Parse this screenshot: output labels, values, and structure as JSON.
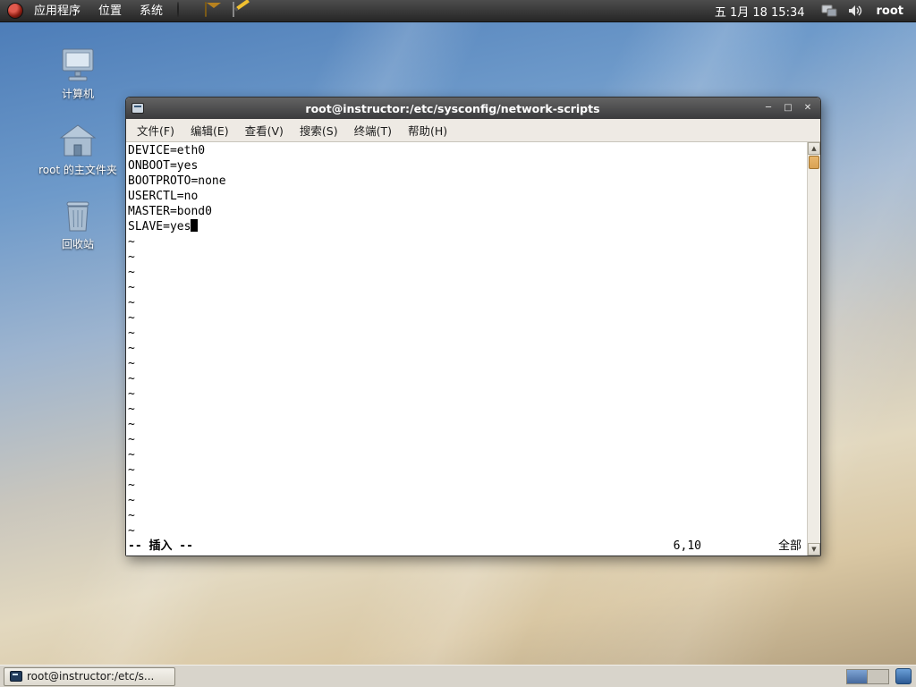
{
  "top_panel": {
    "menus": [
      {
        "label": "应用程序"
      },
      {
        "label": "位置"
      },
      {
        "label": "系统"
      }
    ],
    "clock": "五 1月 18 15:34",
    "user": "root"
  },
  "desktop_icons": [
    {
      "label": "计算机"
    },
    {
      "label": "root 的主文件夹"
    },
    {
      "label": "回收站"
    }
  ],
  "terminal": {
    "title": "root@instructor:/etc/sysconfig/network-scripts",
    "window_controls": {
      "minimize": "─",
      "maximize": "□",
      "close": "✕"
    },
    "menu": [
      "文件(F)",
      "编辑(E)",
      "查看(V)",
      "搜索(S)",
      "终端(T)",
      "帮助(H)"
    ],
    "buffer_lines": [
      "DEVICE=eth0",
      "ONBOOT=yes",
      "BOOTPROTO=none",
      "USERCTL=no",
      "MASTER=bond0",
      "SLAVE=yes"
    ],
    "tilde_char": "~",
    "tilde_count": 20,
    "status": {
      "mode": "-- 插入 --",
      "cursor_position": "6,10",
      "scroll_indicator": "全部"
    },
    "scrollbar": {
      "up_arrow": "▲",
      "down_arrow": "▼"
    }
  },
  "taskbar": {
    "task_button": "root@instructor:/etc/s..."
  }
}
